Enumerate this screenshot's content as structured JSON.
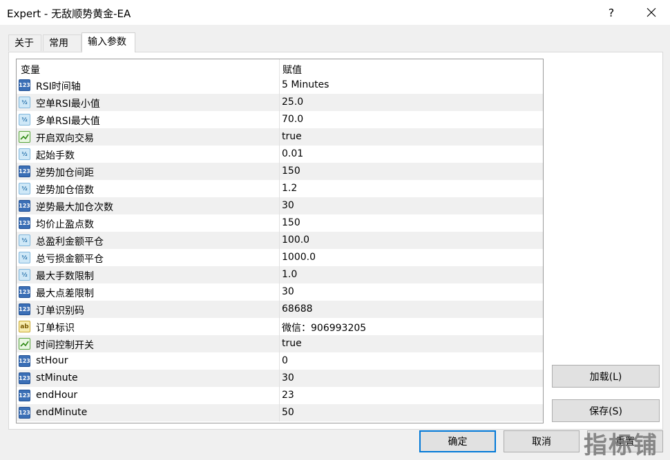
{
  "window": {
    "title": "Expert - 无敌顺势黄金-EA",
    "help_label": "?"
  },
  "tabs": [
    {
      "label": "关于"
    },
    {
      "label": "常用"
    },
    {
      "label": "输入参数"
    }
  ],
  "table": {
    "col_variable": "变量",
    "col_value": "赋值",
    "rows": [
      {
        "icon": "123",
        "name": "RSI时间轴",
        "value": "5 Minutes"
      },
      {
        "icon": "½",
        "name": "空单RSI最小值",
        "value": "25.0"
      },
      {
        "icon": "½",
        "name": "多单RSI最大值",
        "value": "70.0"
      },
      {
        "icon": "bool",
        "name": "开启双向交易",
        "value": "true"
      },
      {
        "icon": "½",
        "name": "起始手数",
        "value": "0.01"
      },
      {
        "icon": "123",
        "name": "逆势加仓间距",
        "value": "150"
      },
      {
        "icon": "½",
        "name": "逆势加仓倍数",
        "value": "1.2"
      },
      {
        "icon": "123",
        "name": "逆势最大加仓次数",
        "value": "30"
      },
      {
        "icon": "123",
        "name": "均价止盈点数",
        "value": "150"
      },
      {
        "icon": "½",
        "name": "总盈利金额平仓",
        "value": "100.0"
      },
      {
        "icon": "½",
        "name": "总亏损金额平仓",
        "value": "1000.0"
      },
      {
        "icon": "½",
        "name": "最大手数限制",
        "value": "1.0"
      },
      {
        "icon": "123",
        "name": "最大点差限制",
        "value": "30"
      },
      {
        "icon": "123",
        "name": "订单识别码",
        "value": "68688"
      },
      {
        "icon": "ab",
        "name": "订单标识",
        "value": "微信：906993205"
      },
      {
        "icon": "bool",
        "name": "时间控制开关",
        "value": "true"
      },
      {
        "icon": "123",
        "name": "stHour",
        "value": "0"
      },
      {
        "icon": "123",
        "name": "stMinute",
        "value": "30"
      },
      {
        "icon": "123",
        "name": "endHour",
        "value": "23"
      },
      {
        "icon": "123",
        "name": "endMinute",
        "value": "50"
      }
    ]
  },
  "buttons": {
    "load": "加载(L)",
    "save": "保存(S)",
    "ok": "确定",
    "cancel": "取消",
    "reset": "重置"
  },
  "watermark": "指标铺"
}
